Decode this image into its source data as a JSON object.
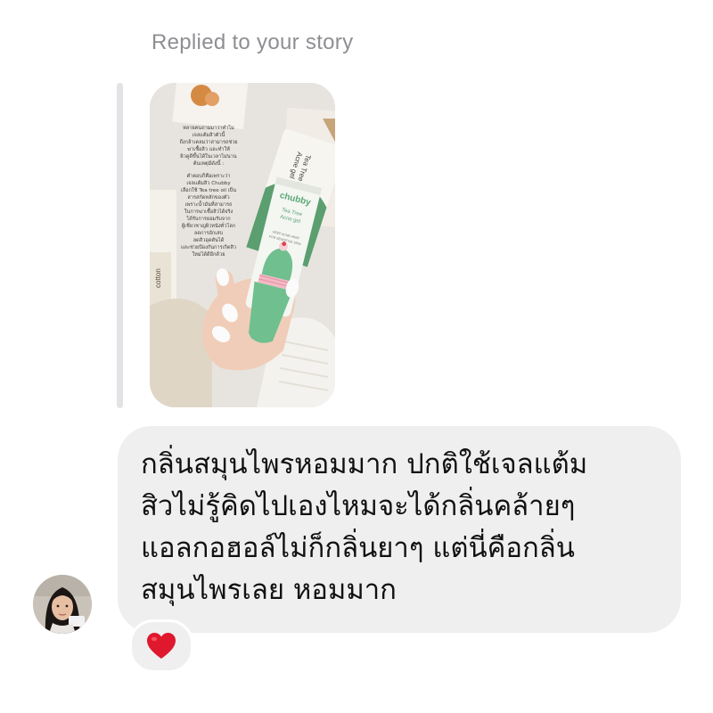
{
  "header": {
    "replied_label": "Replied to your story"
  },
  "story": {
    "caption_lines": [
      "หลายคนถามมาว่าทำไม",
      "เจลแต้มสิวตัวนี้",
      "ถึงกล้าเคลมว่าสามารถช่วย",
      "ฆ่าเชื้อสิว และทำให้",
      "ผิวดูดีขึ้นได้ในเวลาไม่นาน",
      "ต้นเหตุมีดังนี้ :",
      "",
      "คำตอบก็คือเพราะว่า",
      "เจลแต้มสิว Chubby",
      "เลือกใช้ Tea tree oil เป็น",
      "สารสกัดหลักของตัว",
      "เพราะน้ำมันที่สามารถ",
      "ในการฆ่าเชื้อสิวได้จริง",
      "ได้รับการยอมรับจาก",
      "ผู้เชี่ยวชาญผิวหนังทั่วโลก",
      "ลดการอักเสบ",
      "ลดสิวอุดตันได้",
      "และช่วยป้องกันการเกิดสิว",
      "ใหม่ได้ดีอีกด้วย"
    ],
    "tube_brand": "chubby",
    "tube_product_line1": "Tea Tree",
    "tube_product_line2": "Acne gel",
    "tube_small_text1": "KEEP ACNE AWAY",
    "tube_small_text2": "FOR SENSITIVE SKIN",
    "box_text1": "Tea Tree",
    "box_text2": "Acne gel",
    "box_brand": "chubby",
    "side_label": "cotton"
  },
  "message": {
    "text": "กลิ่นสมุนไพรหอมมาก ปกติใช้เจลแต้ม\nสิวไม่รู้คิดไปเองไหมจะได้กลิ่นคล้ายๆ\nแอลกอฮอล์ไม่ก็กลิ่นยาๆ แต่นี่คือกลิ่น\nสมุนไพรเลย หอมมาก"
  },
  "reaction": {
    "emoji": "❤️",
    "color": "#e0182d"
  },
  "colors": {
    "bubble": "#efeff0",
    "label": "#8e8e93",
    "quote_bar": "#e3e3e6",
    "tube_green": "#6fbf8f",
    "tube_white": "#f4f6f2"
  }
}
